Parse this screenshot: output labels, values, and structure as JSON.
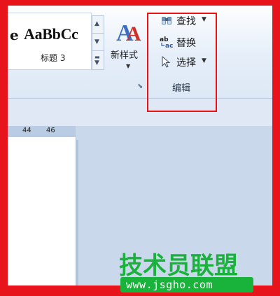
{
  "ribbon": {
    "styles_gallery": {
      "cut_char": "e",
      "sample_text": "AaBbCc",
      "style_name": "标题 3"
    },
    "new_styles": {
      "label": "新样式"
    },
    "editing_group": {
      "find_label": "查找",
      "replace_label": "替换",
      "select_label": "选择",
      "group_label": "编辑"
    }
  },
  "ruler": {
    "numbers": [
      "44",
      "46"
    ]
  },
  "watermark": {
    "title": "技术员联盟",
    "url": "www.jsgho.com"
  },
  "colors": {
    "highlight": "#ee1111",
    "frame": "#e8141c",
    "watermark_green": "#19b23a"
  }
}
